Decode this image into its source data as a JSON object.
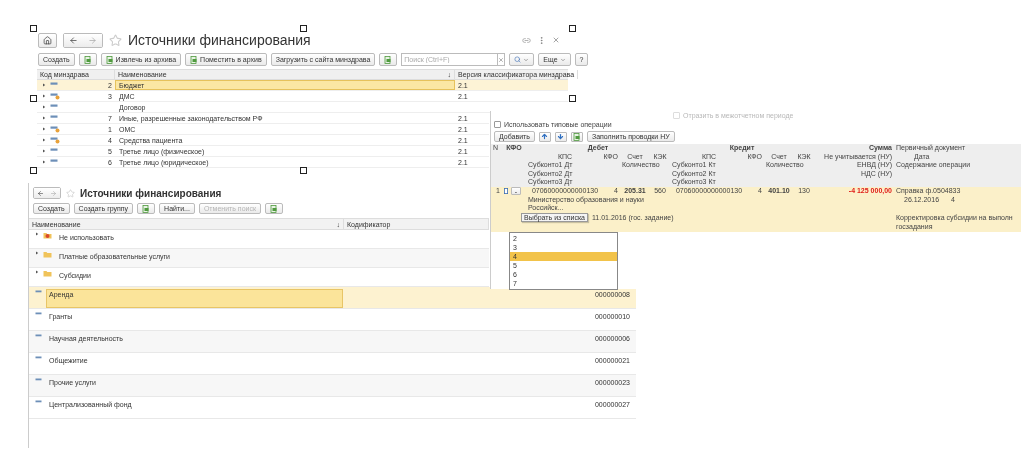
{
  "catalog_window": {
    "title": "Источники финансирования",
    "toolbar": [
      {
        "kind": "text",
        "label": "Создать"
      },
      {
        "kind": "icon"
      },
      {
        "kind": "icon-text",
        "label": "Извлечь из архива"
      },
      {
        "kind": "icon-text",
        "label": "Поместить в архив"
      },
      {
        "kind": "text",
        "label": "Загрузить с сайта минздрава"
      },
      {
        "kind": "icon"
      }
    ],
    "search": {
      "placeholder": "Поиск (Ctrl+F)"
    },
    "more": "Еще",
    "help": "?",
    "columns": [
      "Код минздрава",
      "Наименование",
      "Версия классификатора минздрава"
    ],
    "sort_mark": "↓",
    "rows": [
      {
        "code": "2",
        "name": "Бюджет",
        "version": "2.1",
        "marked": false,
        "selected": true
      },
      {
        "code": "3",
        "name": "ДМС",
        "version": "2.1",
        "marked": true,
        "selected": false
      },
      {
        "name": "Договор",
        "marked": false,
        "selected": false
      },
      {
        "code": "7",
        "name": "Иные, разрешенные законодательством РФ",
        "version": "2.1",
        "marked": false,
        "selected": false
      },
      {
        "code": "1",
        "name": "ОМС",
        "version": "2.1",
        "marked": true,
        "selected": false
      },
      {
        "code": "4",
        "name": "Средства пациента",
        "version": "2.1",
        "marked": true,
        "selected": false
      },
      {
        "code": "5",
        "name": "Третье лицо (физическое)",
        "version": "2.1",
        "marked": false,
        "selected": false
      },
      {
        "code": "6",
        "name": "Третье лицо (юридическое)",
        "version": "2.1",
        "marked": false,
        "selected": false
      }
    ]
  },
  "groups_window": {
    "title": "Источники финансирования",
    "toolbar": [
      {
        "kind": "text",
        "label": "Создать",
        "disabled": false
      },
      {
        "kind": "text",
        "label": "Создать группу",
        "disabled": false
      },
      {
        "kind": "icon",
        "disabled": false
      },
      {
        "kind": "text",
        "label": "Найти...",
        "disabled": false
      },
      {
        "kind": "text",
        "label": "Отменить поиск",
        "disabled": true
      },
      {
        "kind": "icon",
        "disabled": false
      }
    ],
    "columns": [
      "Наименование",
      "Кодификатор"
    ],
    "sort_mark": "↓",
    "rows": [
      {
        "kind": "deleted-group",
        "name": "Не использовать",
        "selected": false
      },
      {
        "kind": "group",
        "name": "Платные образовательные услуги",
        "selected": false
      },
      {
        "kind": "group",
        "name": "Субсидии",
        "selected": false
      },
      {
        "kind": "item",
        "name": "Аренда",
        "code": "000000008",
        "selected": true
      },
      {
        "kind": "item",
        "name": "Гранты",
        "code": "000000010",
        "selected": false
      },
      {
        "kind": "item",
        "name": "Научная деятельность",
        "code": "000000006",
        "selected": false
      },
      {
        "kind": "item",
        "name": "Общежитие",
        "code": "000000021",
        "selected": false
      },
      {
        "kind": "item",
        "name": "Прочие услуги",
        "code": "000000023",
        "selected": false
      },
      {
        "kind": "item",
        "name": "Централизованный фонд",
        "code": "000000027",
        "selected": false
      }
    ]
  },
  "operations_window": {
    "period_checkbox": {
      "label": "Отразить в межотчетном периоде",
      "checked": false,
      "disabled": true
    },
    "typical_checkbox": {
      "label": "Использовать типовые операции",
      "checked": false,
      "disabled": false
    },
    "toolbar": [
      {
        "kind": "text",
        "label": "Добавить"
      },
      {
        "kind": "up"
      },
      {
        "kind": "down"
      },
      {
        "kind": "icon"
      },
      {
        "kind": "text",
        "label": "Заполнить проводки НУ"
      }
    ],
    "columns": {
      "n": "N",
      "kfo": "КФО",
      "debit": {
        "title": "Дебет",
        "kps": "КПС",
        "kfo": "КФО",
        "account": "Счет",
        "kek": "КЭК",
        "sub1": "Субконто1 Дт",
        "sub2": "Субконто2 Дт",
        "sub3": "Субконто3 Дт",
        "quantity": "Количество"
      },
      "credit": {
        "title": "Кредит",
        "kps": "КПС",
        "kfo": "КФО",
        "account": "Счет",
        "kek": "КЭК",
        "sub1": "Субконто1 Кт",
        "sub2": "Субконто2 Кт",
        "sub3": "Субконто3 Кт",
        "quantity": "Количество"
      },
      "sum": {
        "title": "Сумма",
        "not_counted": "Не учитывается (НУ)",
        "envd": "ЕНВД (НУ)",
        "vat": "НДС (НУ)"
      },
      "document": {
        "title": "Первичный документ",
        "date": "Дата",
        "content": "Содержание операции"
      }
    },
    "rows": [
      {
        "n": "1",
        "kfo_button": "-",
        "selected": true,
        "debit": {
          "kps": "07060000000000130",
          "kfo": "4",
          "account": "205.31",
          "kek": "560",
          "sub1": "Министерство образования и науки Российск...",
          "sub2": "11.01.2016 (гос. задание)"
        },
        "credit": {
          "kps": "07060000000000130",
          "kfo": "4",
          "account": "401.10",
          "kek": "130"
        },
        "sum": "-4 125 000,00",
        "negative": true,
        "document": {
          "name": "Справка ф.0504833",
          "date": "26.12.2016",
          "number": "4",
          "content": [
            "Корректировка субсидии на выполн",
            "госзадания"
          ]
        }
      }
    ],
    "tooltip": "Выбрать из списка",
    "dropdown": [
      {
        "label": "2",
        "selected": false
      },
      {
        "label": "3",
        "selected": false
      },
      {
        "label": "4",
        "selected": true
      },
      {
        "label": "5",
        "selected": false
      },
      {
        "label": "6",
        "selected": false
      },
      {
        "label": "7",
        "selected": false
      }
    ]
  }
}
